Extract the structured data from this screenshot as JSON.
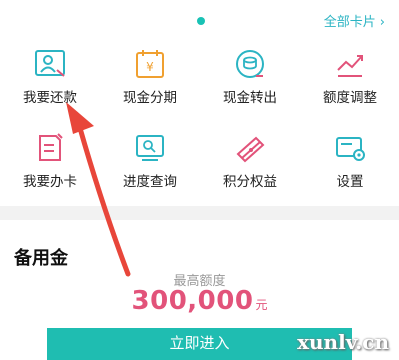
{
  "header": {
    "all_cards": "全部卡片",
    "chevron": "›"
  },
  "menu": [
    {
      "label": "我要还款",
      "icon": "id-card-icon"
    },
    {
      "label": "现金分期",
      "icon": "yuan-calendar-icon"
    },
    {
      "label": "现金转出",
      "icon": "coin-transfer-icon"
    },
    {
      "label": "额度调整",
      "icon": "trend-chart-icon"
    },
    {
      "label": "我要办卡",
      "icon": "edit-document-icon"
    },
    {
      "label": "进度查询",
      "icon": "search-screen-icon"
    },
    {
      "label": "积分权益",
      "icon": "points-card-icon"
    },
    {
      "label": "设置",
      "icon": "gear-card-icon"
    }
  ],
  "reserve": {
    "title": "备用金",
    "limit_label": "最高额度",
    "limit_value": "300,000",
    "limit_unit": "元",
    "button": "立即进入"
  },
  "watermark": "xunlv.cn",
  "colors": {
    "accent": "#19c2b5",
    "icon_teal": "#2bb4c3",
    "icon_pink": "#e2537a",
    "icon_orange": "#f0a030",
    "arrow": "#e8463a"
  }
}
